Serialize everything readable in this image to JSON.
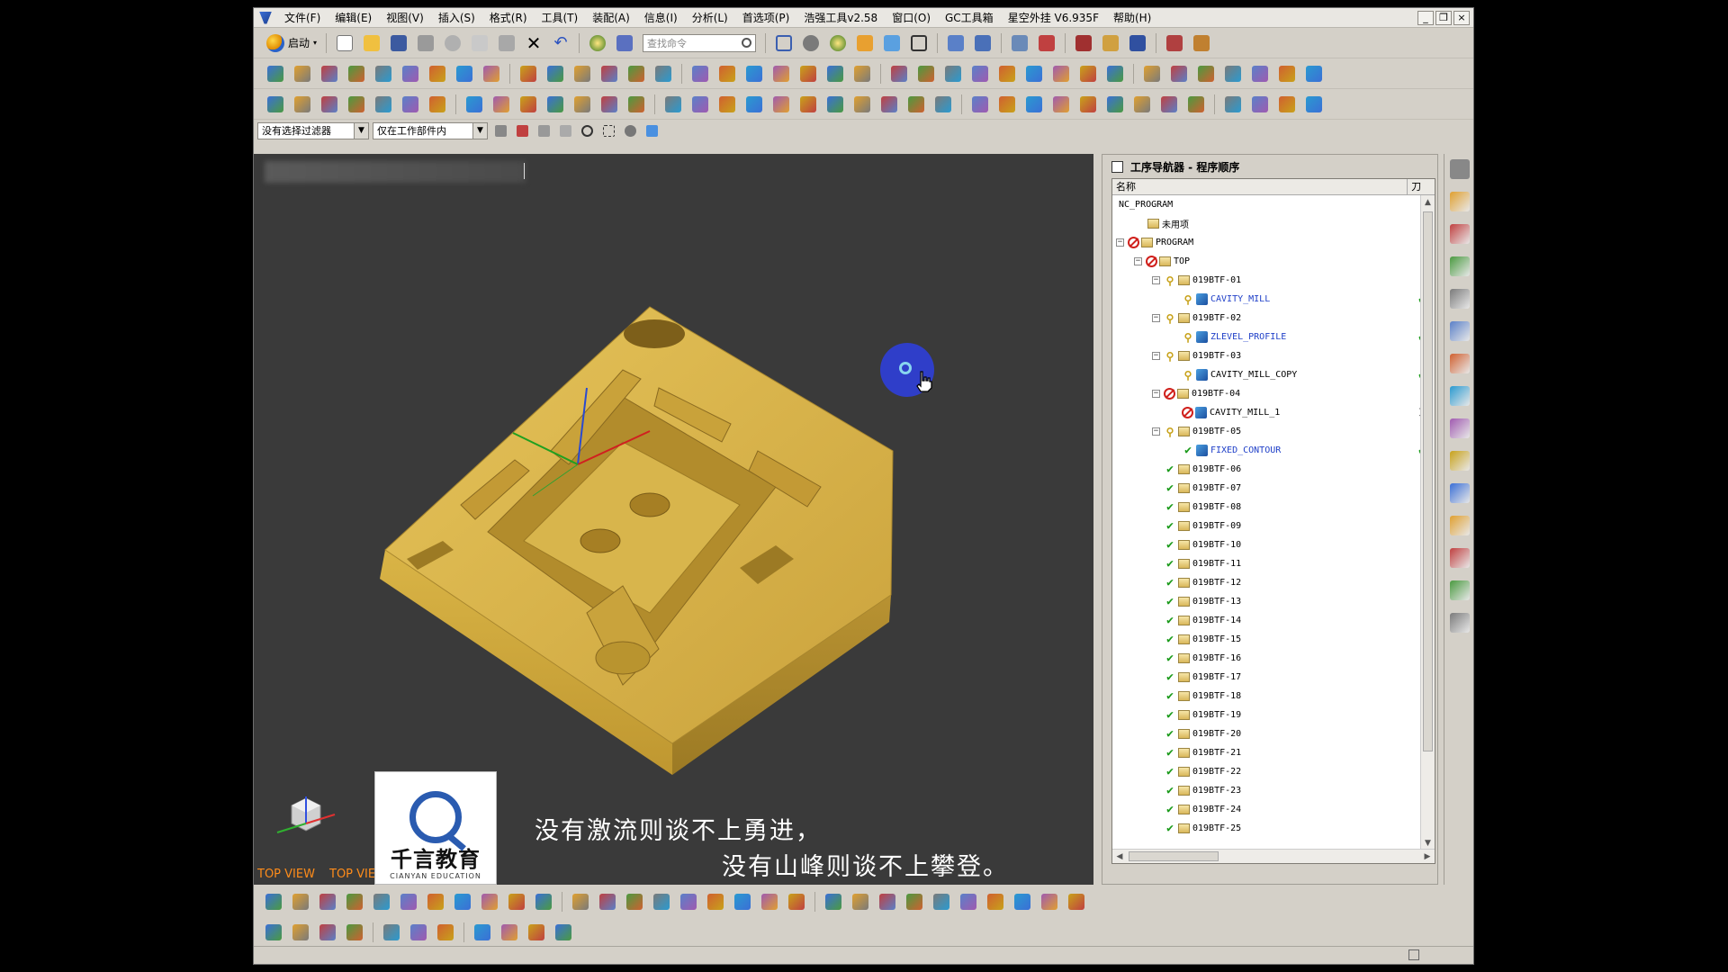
{
  "menu": [
    "文件(F)",
    "编辑(E)",
    "视图(V)",
    "插入(S)",
    "格式(R)",
    "工具(T)",
    "装配(A)",
    "信息(I)",
    "分析(L)",
    "首选项(P)",
    "浩强工具v2.58",
    "窗口(O)",
    "GC工具箱",
    "星空外挂 V6.935F",
    "帮助(H)"
  ],
  "window_controls": [
    "_",
    "❐",
    "×"
  ],
  "toolbar": {
    "start_label": "启动",
    "search_placeholder": "查找命令"
  },
  "selection": {
    "filter_value": "没有选择过滤器",
    "scope_value": "仅在工作部件内"
  },
  "viewport": {
    "view_label": "TOP VIEW",
    "caption_line1": "没有激流则谈不上勇进，",
    "caption_line2": "没有山峰则谈不上攀登。",
    "logo_main": "千言教育",
    "logo_sub": "CIANYAN EDUCATION"
  },
  "navigator": {
    "title": "工序导航器 - 程序顺序",
    "col_name": "名称",
    "col_tool": "刀",
    "rows": [
      {
        "label": "NC_PROGRAM",
        "indent": 0,
        "exp": "",
        "status": "",
        "icon": "",
        "check": ""
      },
      {
        "label": "未用项",
        "indent": 1,
        "exp": "",
        "status": "",
        "icon": "folder",
        "check": ""
      },
      {
        "label": "PROGRAM",
        "indent": 0,
        "exp": "⊟",
        "status": "no",
        "icon": "folder",
        "check": ""
      },
      {
        "label": "TOP",
        "indent": 1,
        "exp": "⊟",
        "status": "no",
        "icon": "folder",
        "check": ""
      },
      {
        "label": "019BTF-01",
        "indent": 2,
        "exp": "⊟",
        "status": "pend",
        "icon": "folder",
        "check": ""
      },
      {
        "label": "CAVITY_MILL",
        "indent": 3,
        "exp": "",
        "status": "pend",
        "icon": "op",
        "check": "ok",
        "blue": true
      },
      {
        "label": "019BTF-02",
        "indent": 2,
        "exp": "⊟",
        "status": "pend",
        "icon": "folder",
        "check": ""
      },
      {
        "label": "ZLEVEL_PROFILE",
        "indent": 3,
        "exp": "",
        "status": "pend",
        "icon": "op",
        "check": "ok",
        "blue": true
      },
      {
        "label": "019BTF-03",
        "indent": 2,
        "exp": "⊟",
        "status": "pend",
        "icon": "folder",
        "check": ""
      },
      {
        "label": "CAVITY_MILL_COPY",
        "indent": 3,
        "exp": "",
        "status": "pend",
        "icon": "op",
        "check": "ok"
      },
      {
        "label": "019BTF-04",
        "indent": 2,
        "exp": "⊟",
        "status": "no",
        "icon": "folder",
        "check": ""
      },
      {
        "label": "CAVITY_MILL_1",
        "indent": 3,
        "exp": "",
        "status": "no",
        "icon": "op",
        "check": "x"
      },
      {
        "label": "019BTF-05",
        "indent": 2,
        "exp": "⊟",
        "status": "pend",
        "icon": "folder",
        "check": ""
      },
      {
        "label": "FIXED_CONTOUR",
        "indent": 3,
        "exp": "",
        "status": "ok",
        "icon": "op",
        "check": "ok",
        "blue": true
      },
      {
        "label": "019BTF-06",
        "indent": 2,
        "exp": "",
        "status": "ok",
        "icon": "folder",
        "check": ""
      },
      {
        "label": "019BTF-07",
        "indent": 2,
        "exp": "",
        "status": "ok",
        "icon": "folder",
        "check": ""
      },
      {
        "label": "019BTF-08",
        "indent": 2,
        "exp": "",
        "status": "ok",
        "icon": "folder",
        "check": ""
      },
      {
        "label": "019BTF-09",
        "indent": 2,
        "exp": "",
        "status": "ok",
        "icon": "folder",
        "check": ""
      },
      {
        "label": "019BTF-10",
        "indent": 2,
        "exp": "",
        "status": "ok",
        "icon": "folder",
        "check": ""
      },
      {
        "label": "019BTF-11",
        "indent": 2,
        "exp": "",
        "status": "ok",
        "icon": "folder",
        "check": ""
      },
      {
        "label": "019BTF-12",
        "indent": 2,
        "exp": "",
        "status": "ok",
        "icon": "folder",
        "check": ""
      },
      {
        "label": "019BTF-13",
        "indent": 2,
        "exp": "",
        "status": "ok",
        "icon": "folder",
        "check": ""
      },
      {
        "label": "019BTF-14",
        "indent": 2,
        "exp": "",
        "status": "ok",
        "icon": "folder",
        "check": ""
      },
      {
        "label": "019BTF-15",
        "indent": 2,
        "exp": "",
        "status": "ok",
        "icon": "folder",
        "check": ""
      },
      {
        "label": "019BTF-16",
        "indent": 2,
        "exp": "",
        "status": "ok",
        "icon": "folder",
        "check": ""
      },
      {
        "label": "019BTF-17",
        "indent": 2,
        "exp": "",
        "status": "ok",
        "icon": "folder",
        "check": ""
      },
      {
        "label": "019BTF-18",
        "indent": 2,
        "exp": "",
        "status": "ok",
        "icon": "folder",
        "check": ""
      },
      {
        "label": "019BTF-19",
        "indent": 2,
        "exp": "",
        "status": "ok",
        "icon": "folder",
        "check": ""
      },
      {
        "label": "019BTF-20",
        "indent": 2,
        "exp": "",
        "status": "ok",
        "icon": "folder",
        "check": ""
      },
      {
        "label": "019BTF-21",
        "indent": 2,
        "exp": "",
        "status": "ok",
        "icon": "folder",
        "check": ""
      },
      {
        "label": "019BTF-22",
        "indent": 2,
        "exp": "",
        "status": "ok",
        "icon": "folder",
        "check": ""
      },
      {
        "label": "019BTF-23",
        "indent": 2,
        "exp": "",
        "status": "ok",
        "icon": "folder",
        "check": ""
      },
      {
        "label": "019BTF-24",
        "indent": 2,
        "exp": "",
        "status": "ok",
        "icon": "folder",
        "check": ""
      },
      {
        "label": "019BTF-25",
        "indent": 2,
        "exp": "",
        "status": "ok",
        "icon": "folder",
        "check": ""
      }
    ]
  },
  "colors": {
    "model": "#d8b446",
    "viewport_bg": "#3a3a3a",
    "view_label": "#ff8c1a",
    "cursor_dot": "#2f3fd6"
  }
}
